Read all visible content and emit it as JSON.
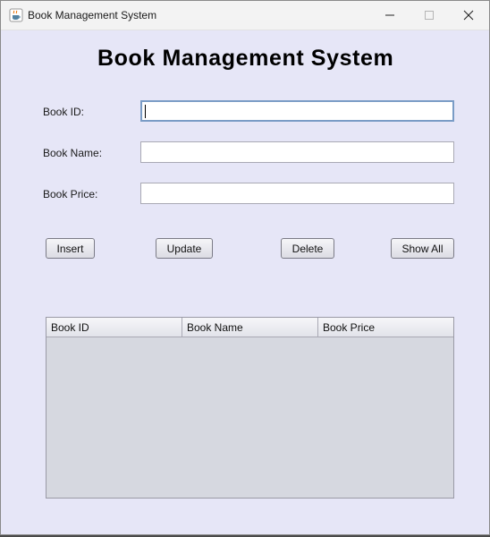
{
  "window": {
    "title": "Book Management System",
    "icon": "java-cup-icon"
  },
  "header": {
    "title": "Book Management System"
  },
  "form": {
    "book_id": {
      "label": "Book ID:",
      "value": ""
    },
    "book_name": {
      "label": "Book Name:",
      "value": ""
    },
    "book_price": {
      "label": "Book Price:",
      "value": ""
    }
  },
  "buttons": {
    "insert": "Insert",
    "update": "Update",
    "delete": "Delete",
    "show_all": "Show All"
  },
  "table": {
    "columns": [
      "Book ID",
      "Book Name",
      "Book Price"
    ],
    "rows": []
  }
}
